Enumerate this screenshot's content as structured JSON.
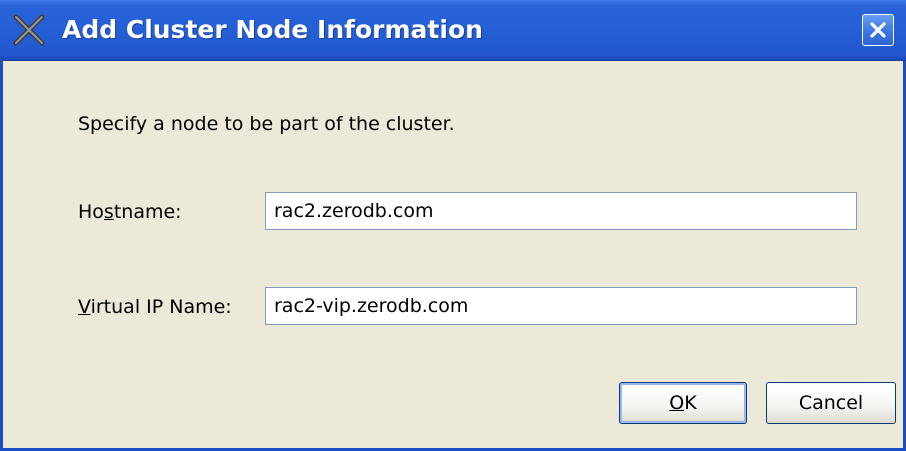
{
  "dialog": {
    "title": "Add Cluster Node Information",
    "logo_icon": "oracle-x-logo-icon",
    "close_icon": "close-icon",
    "title_bar_color": "#245fd6"
  },
  "instruction": "Specify a node to be part of the cluster.",
  "fields": {
    "hostname": {
      "label_pre": "Ho",
      "label_mnemonic": "s",
      "label_post": "tname:",
      "value": "rac2.zerodb.com"
    },
    "virtual_ip": {
      "label_pre": "",
      "label_mnemonic": "V",
      "label_post": "irtual IP Name:",
      "value": "rac2-vip.zerodb.com"
    }
  },
  "buttons": {
    "ok": {
      "label_pre": "",
      "label_mnemonic": "O",
      "label_post": "K"
    },
    "cancel": {
      "label": "Cancel"
    }
  }
}
